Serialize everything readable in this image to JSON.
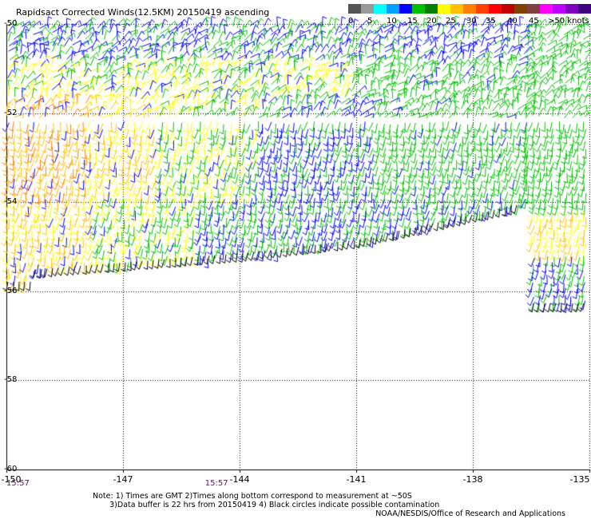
{
  "title": "Rapidsact Corrected Winds(12.5KM) 20150419 ascending",
  "legend": {
    "bins": [
      {
        "color": "#555555"
      },
      {
        "color": "#999999"
      },
      {
        "color": "#00ffff"
      },
      {
        "color": "#00a0ff"
      },
      {
        "color": "#0000ff"
      },
      {
        "color": "#00c000"
      },
      {
        "color": "#008000"
      },
      {
        "color": "#ffff00"
      },
      {
        "color": "#ffc000"
      },
      {
        "color": "#ff8000"
      },
      {
        "color": "#ff4000"
      },
      {
        "color": "#ff0000"
      },
      {
        "color": "#c00000"
      },
      {
        "color": "#804000"
      },
      {
        "color": "#804040"
      },
      {
        "color": "#ff00ff"
      },
      {
        "color": "#c000ff"
      },
      {
        "color": "#8000c0"
      },
      {
        "color": "#400080"
      }
    ],
    "labels": [
      "0",
      "5",
      "10",
      "15",
      "20",
      "25",
      "30",
      "35",
      "40",
      "45",
      ">50 knots"
    ]
  },
  "axes": {
    "lat_labels": [
      "-50",
      "-52",
      "-54",
      "-56",
      "-58",
      "-60"
    ],
    "lat_values": [
      -50,
      -52,
      -54,
      -56,
      -58,
      -60
    ],
    "lon_labels": [
      "-150",
      "-147",
      "-144",
      "-141",
      "-138",
      "-135"
    ],
    "lon_values": [
      -150,
      -147,
      -144,
      -141,
      -138,
      -135
    ]
  },
  "time_labels": [
    {
      "text": "15:57",
      "lon": -150
    },
    {
      "text": "15:57",
      "lon": -144.6
    }
  ],
  "notes": "Note: 1) Times are GMT 2)Times along bottom correspond to measurement at ~50S\n       3)Data buffer is 22 hrs from 20150419 4) Black circles indicate possible contamination",
  "credit": "NOAA/NESDIS/Office of Research and Applications",
  "wind_speed_color_scale": [
    "#0000ff",
    "#00c000",
    "#ffff00",
    "#ffc000",
    "#ff8000",
    "#ff4000"
  ]
}
